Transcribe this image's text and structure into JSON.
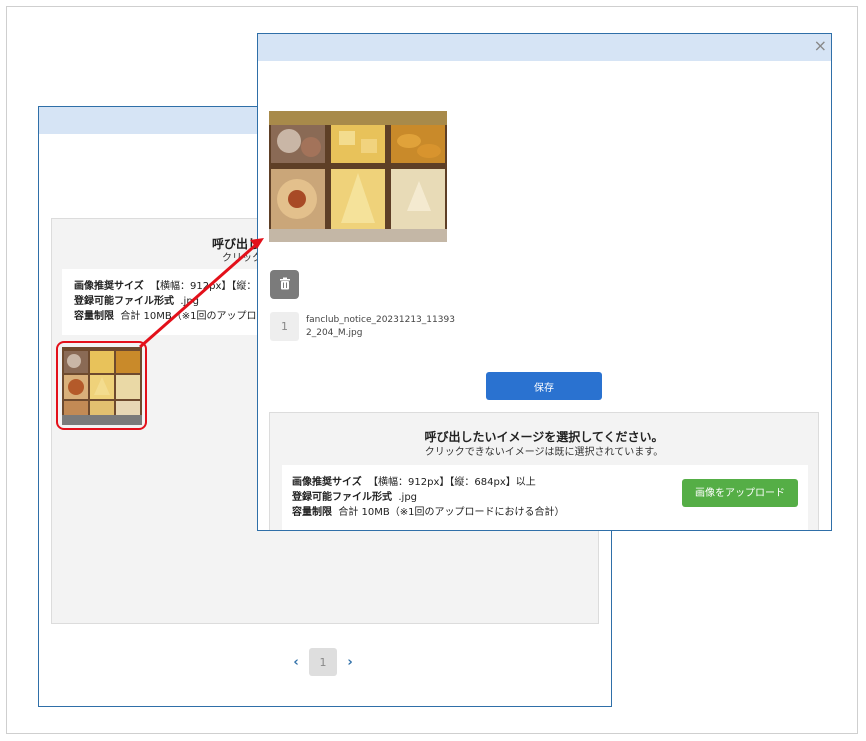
{
  "back_dialog": {
    "title_partial": "呼び出し",
    "subtitle_partial": "クリックで",
    "info": {
      "size_label": "画像推奨サイズ",
      "size_value_partial": "【横幅：912px】【縦：",
      "format_label": "登録可能ファイル形式",
      "format_value": ".jpg",
      "capacity_label": "容量制限",
      "capacity_value_partial": "合計 10MB（※1回のアップロード"
    },
    "pagination": {
      "prev": "‹",
      "page": "1",
      "next": "›"
    }
  },
  "front_dialog": {
    "close_label": "×",
    "file": {
      "index": "1",
      "name": "fanclub_notice_20231213_113932_204_M.jpg"
    },
    "save_label": "保存",
    "panel": {
      "title": "呼び出したいイメージを選択してください。",
      "subtitle": "クリックできないイメージは既に選択されています。",
      "size_label": "画像推奨サイズ",
      "size_value": "【横幅：912px】【縦：684px】以上",
      "format_label": "登録可能ファイル形式",
      "format_value": ".jpg",
      "capacity_label": "容量制限",
      "capacity_value": "合計 10MB（※1回のアップロードにおける合計）",
      "upload_label": "画像をアップロード"
    }
  },
  "colors": {
    "header_bg": "#d6e4f5",
    "border": "#2f6fa8",
    "highlight": "#e3101a",
    "save_button": "#2a72d0",
    "upload_button": "#55ae46"
  }
}
